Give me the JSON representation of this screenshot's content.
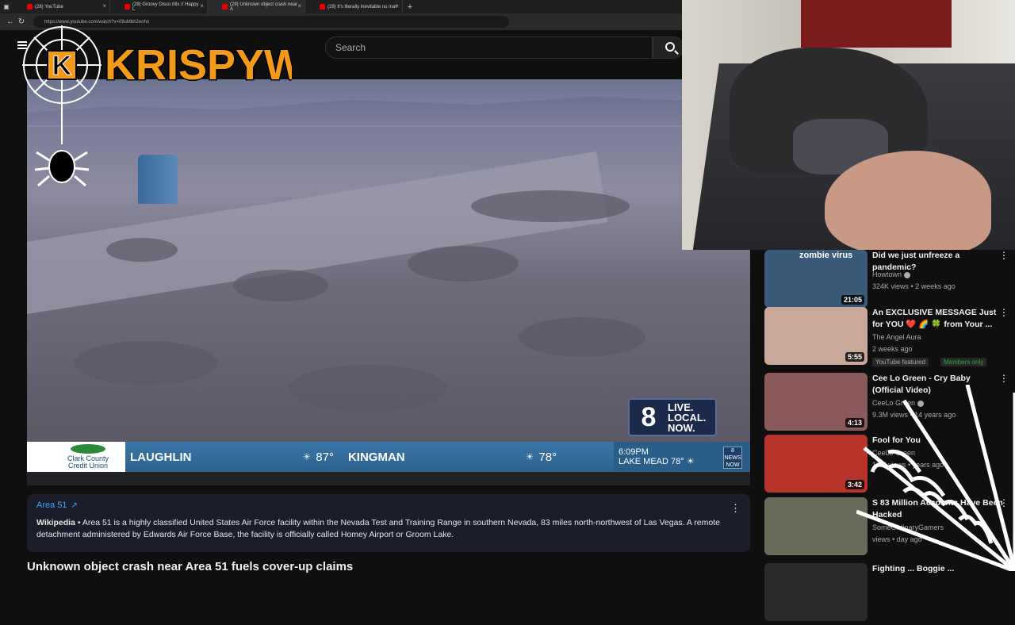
{
  "browser": {
    "tabs": [
      {
        "label": "(28) YouTube",
        "active": false
      },
      {
        "label": "(28) Groovy Disco Mix // Happy L",
        "active": false
      },
      {
        "label": "(29) Unknown object crash near A",
        "active": true
      },
      {
        "label": "(29) It's literally inevitable no mat",
        "active": false
      }
    ],
    "new_tab": "+",
    "url": "https://www.youtube.com/watch?v=09uMbh2eoho"
  },
  "youtube": {
    "search_placeholder": "Search"
  },
  "overlay": {
    "logo_text": "KRISPYW",
    "logo_letter": "K"
  },
  "player": {
    "station": {
      "number": "8",
      "line1": "LIVE.",
      "line2": "LOCAL.",
      "line3": "NOW."
    },
    "ticker": {
      "sponsor_line1": "Clark County",
      "sponsor_line2": "Credit Union",
      "city1": "LAUGHLIN",
      "temp1": "87°",
      "city2": "KINGMAN",
      "temp2": "78°",
      "time": "6:09PM",
      "place": "LAKE MEAD",
      "temp3": "78°",
      "badge": "8 NEWS NOW"
    }
  },
  "info_panel": {
    "title": "Area 51",
    "source": "Wikipedia",
    "body": " • Area 51 is a highly classified United States Air Force facility within the Nevada Test and Training Range in southern Nevada, 83 miles north-northwest of Las Vegas. A remote detachment administered by Edwards Air Force Base, the facility is officially called Homey Airport or Groom Lake."
  },
  "video_title": "Unknown object crash near Area 51 fuels cover-up claims",
  "recommendations": [
    {
      "title": "Did we just unfreeze a pandemic?",
      "channel": "Howtown",
      "meta": "324K views • 2 weeks ago",
      "duration": "21:05",
      "thumb_text": "zombie virus",
      "thumb_color": "#3a5a7a"
    },
    {
      "title": "An EXCLUSIVE MESSAGE Just for YOU ❤️ 🌈 🍀 from Your ...",
      "channel": "The Angel Aura",
      "meta": "2 weeks ago",
      "duration": "5:55",
      "badge1": "YouTube featured",
      "badge2": "Members only",
      "thumb_color": "#c9a89a"
    },
    {
      "title": "Cee Lo Green - Cry Baby (Official Video)",
      "channel": "CeeLo Green",
      "meta": "9.3M views • 14 years ago",
      "duration": "4:13",
      "thumb_color": "#8a5a5a"
    },
    {
      "title": "Fool for You",
      "channel": "CeeLo Green",
      "meta": "17M views • years ago",
      "duration": "3:42",
      "thumb_color": "#b8332a"
    },
    {
      "title": "S 83 Million Accounts Have Been Hacked",
      "channel": "SomeOrdinaryGamers",
      "meta": "views • day ago",
      "duration": "",
      "thumb_color": "#6a6a5a"
    },
    {
      "title": "Fighting ... Boggie ...",
      "channel": "",
      "meta": "",
      "duration": "",
      "thumb_color": "#2a2a2a"
    }
  ]
}
